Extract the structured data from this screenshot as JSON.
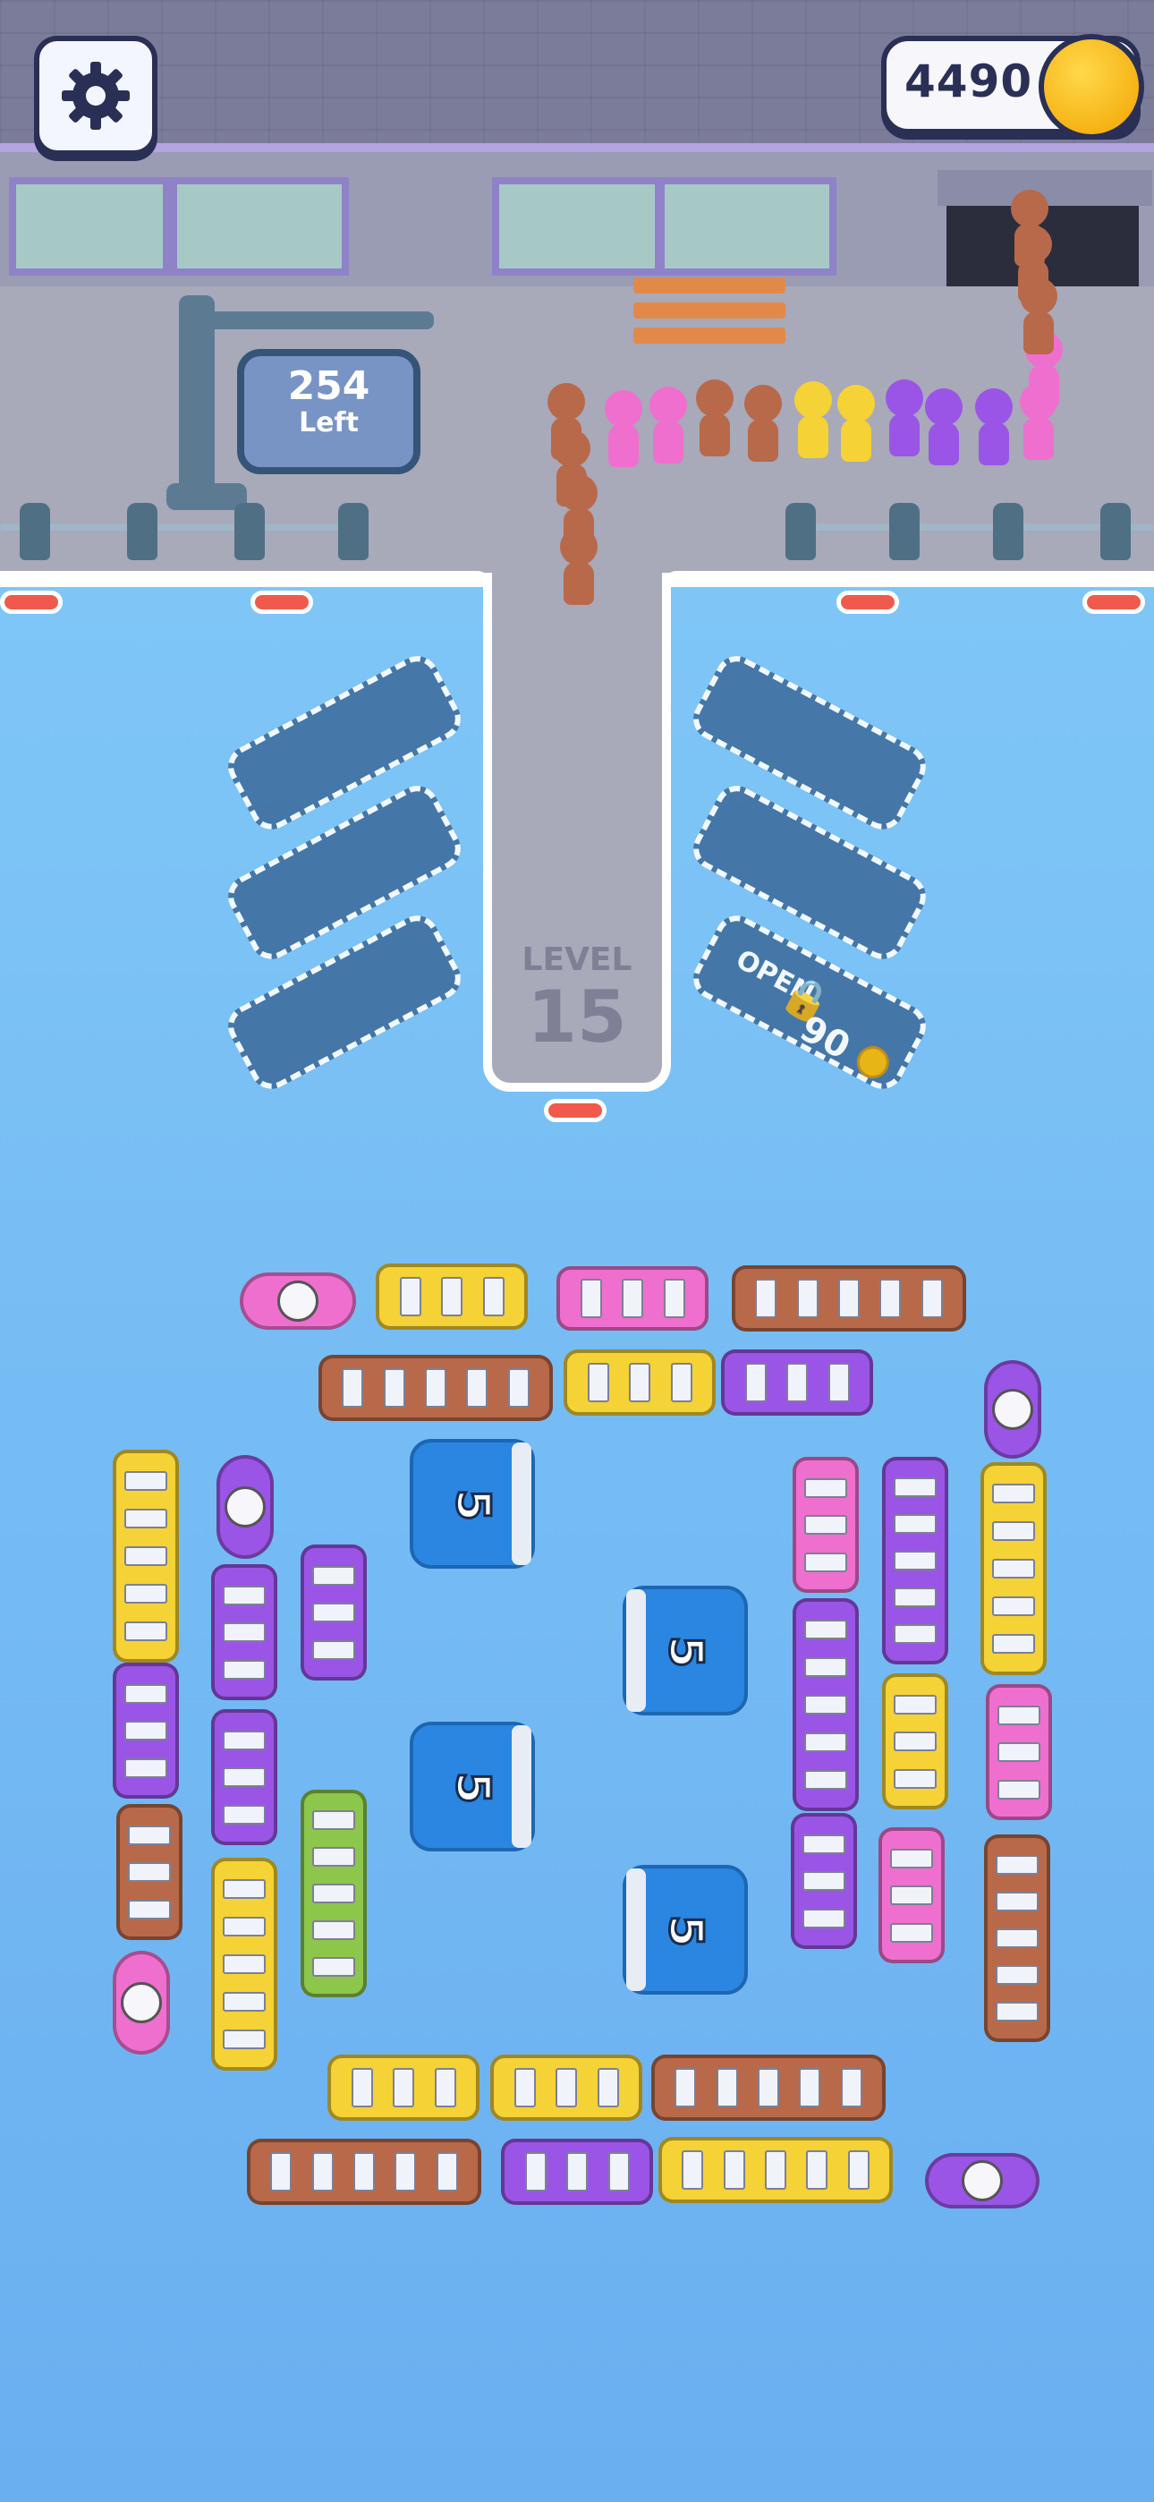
{
  "hud": {
    "settings_icon": "gear-icon",
    "coins": "4490",
    "coin_icon": "coin-icon"
  },
  "sign": {
    "count": "254",
    "label": "Left"
  },
  "level": {
    "label": "LEVEL",
    "number": "15"
  },
  "locked_slot": {
    "label": "OPEN",
    "price": "90",
    "lock_icon": "lock-icon"
  },
  "pads": [
    {
      "value": "5"
    },
    {
      "value": "5"
    },
    {
      "value": "5"
    },
    {
      "value": "5"
    }
  ],
  "colors": {
    "yellow": "#f5d235",
    "pink": "#ef6fcf",
    "purple": "#9a55e6",
    "brown": "#b8694a",
    "green": "#8cc64a",
    "water": "#7ec3f5"
  }
}
